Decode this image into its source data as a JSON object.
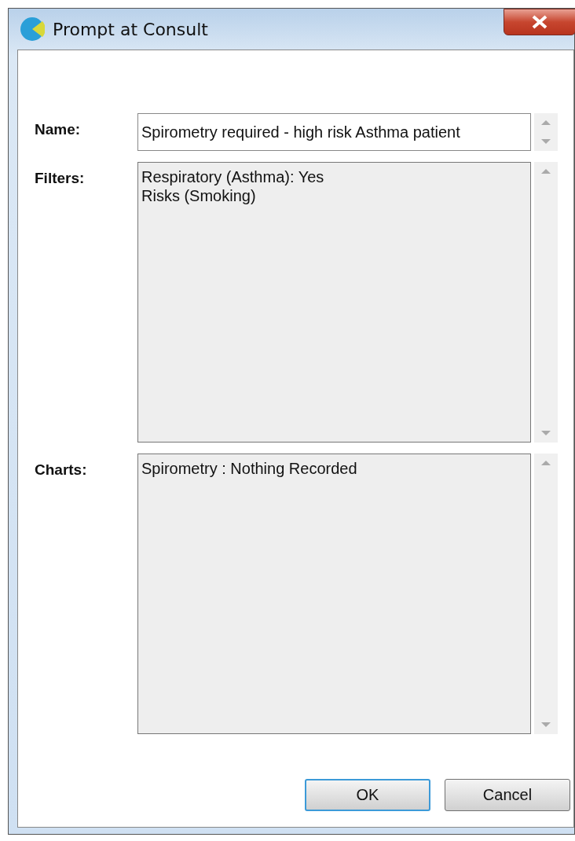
{
  "window": {
    "title": "Prompt at Consult"
  },
  "fields": [
    {
      "kind": "input",
      "label": "Name:",
      "value": "Spirometry required - high risk Asthma patient"
    },
    {
      "kind": "list",
      "label": "Filters:",
      "lines": [
        "Respiratory (Asthma): Yes",
        "Risks (Smoking)"
      ]
    },
    {
      "kind": "list",
      "label": "Charts:",
      "lines": [
        "Spirometry : Nothing Recorded"
      ]
    }
  ],
  "buttons": [
    {
      "label": "OK",
      "default": true
    },
    {
      "label": "Cancel",
      "default": false
    }
  ]
}
